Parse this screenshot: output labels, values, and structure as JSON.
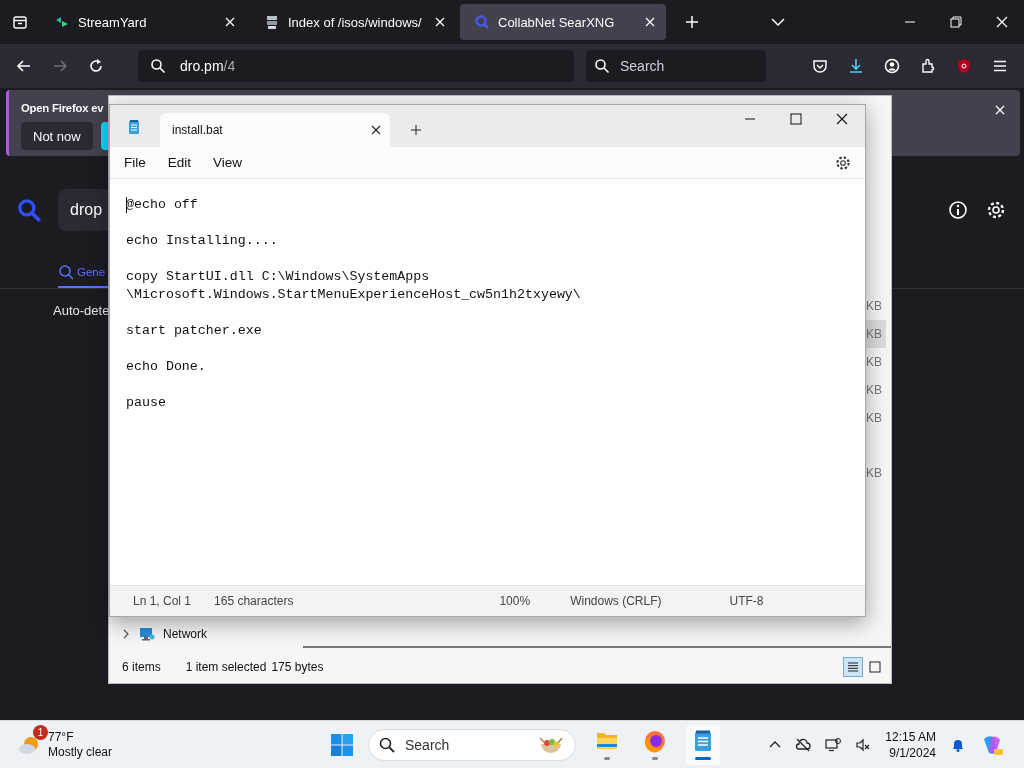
{
  "browser": {
    "tabs": [
      {
        "title": "StreamYard",
        "selected": false
      },
      {
        "title": "Index of /isos/windows/",
        "selected": false
      },
      {
        "title": "CollabNet SearXNG",
        "selected": true
      }
    ],
    "address": {
      "host": "dro.pm",
      "path": "/4"
    },
    "search": {
      "placeholder": "Search"
    },
    "notification": {
      "title": "Open Firefox ev",
      "dismiss_button": "Not now"
    },
    "page": {
      "query": "drop",
      "category_tab": "Gene",
      "language": "Auto-dete"
    }
  },
  "explorer": {
    "size_cells": [
      {
        "text": "KB",
        "selected": false
      },
      {
        "text": "KB",
        "selected": true
      },
      {
        "text": "KB",
        "selected": false
      },
      {
        "text": "KB",
        "selected": false
      },
      {
        "text": "KB",
        "selected": false
      },
      {
        "text": "KB",
        "selected": false
      }
    ],
    "tree_item": "Network",
    "status": {
      "item_count": "6 items",
      "selection": "1 item selected",
      "size": "175 bytes"
    },
    "views": [
      {
        "kind": "details",
        "selected": true
      },
      {
        "kind": "tiles",
        "selected": false
      }
    ]
  },
  "notepad": {
    "tab": "install.bat",
    "menu": [
      "File",
      "Edit",
      "View"
    ],
    "lines": [
      "@echo off",
      "echo Installing....",
      "copy StartUI.dll C:\\Windows\\SystemApps \\Microsoft.Windows.StartMenuExperienceHost_cw5n1h2txyewy\\",
      "start patcher.exe",
      "echo Done.",
      "pause"
    ],
    "status": {
      "position": "Ln 1, Col 1",
      "characters": "165 characters",
      "zoom": "100%",
      "line_ending": "Windows (CRLF)",
      "encoding": "UTF-8"
    }
  },
  "taskbar": {
    "weather": {
      "badge": "1",
      "temperature": "77°F",
      "condition": "Mostly clear"
    },
    "search": {
      "placeholder": "Search"
    },
    "apps": [
      {
        "kind": "explorer",
        "active": false
      },
      {
        "kind": "firefox",
        "active": false
      },
      {
        "kind": "notepad",
        "active": true
      }
    ],
    "clock": {
      "time": "12:15 AM",
      "date": "9/1/2024"
    }
  }
}
